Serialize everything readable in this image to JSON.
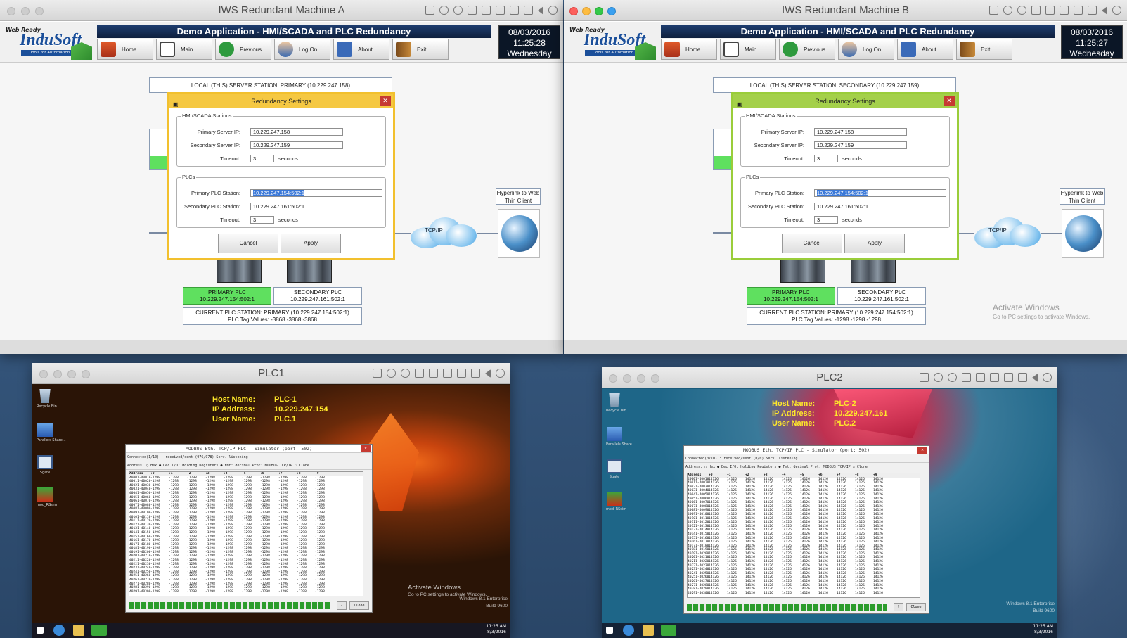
{
  "machine_a": {
    "window_title": "IWS Redundant Machine A",
    "logo": {
      "top": "Web Ready",
      "name": "InduSoft",
      "sub": "Tools for Automation"
    },
    "app_title": "Demo Application - HMI/SCADA and PLC Redundancy",
    "nav": [
      "Home",
      "Main",
      "Previous",
      "Log On...",
      "About...",
      "Exit"
    ],
    "date": "08/03/2016",
    "time": "11:25:28",
    "day": "Wednesday",
    "local_station": "LOCAL (THIS) SERVER STATION: PRIMARY (10.229.247.158)",
    "dialog": {
      "title": "Redundancy Settings",
      "close": "✕",
      "hmi_group": "HMI/SCADA Stations",
      "primary_server_label": "Primary Server IP:",
      "primary_server": "10.229.247.158",
      "secondary_server_label": "Secondary Server IP:",
      "secondary_server": "10.229.247.159",
      "timeout_label": "Timeout:",
      "timeout_hmi": "3",
      "seconds": "seconds",
      "plc_group": "PLCs",
      "primary_plc_label": "Primary PLC Station:",
      "primary_plc": "10.229.247.154:502:1",
      "secondary_plc_label": "Secondary PLC Station:",
      "secondary_plc": "10.229.247.161:502:1",
      "timeout_plc": "3",
      "cancel": "Cancel",
      "apply": "Apply"
    },
    "hyperlink": "Hyperlink to Web Thin Client",
    "cloud_label": "TCP/IP",
    "primary_plc_box": {
      "title": "PRIMARY PLC",
      "ip": "10.229.247.154:502:1"
    },
    "secondary_plc_box": {
      "title": "SECONDARY PLC",
      "ip": "10.229.247.161:502:1"
    },
    "current_station": "CURRENT PLC STATION: PRIMARY (10.229.247.154:502:1)",
    "tag_values": "PLC Tag Values: -3868 -3868 -3868"
  },
  "machine_b": {
    "window_title": "IWS Redundant Machine B",
    "logo": {
      "top": "Web Ready",
      "name": "InduSoft",
      "sub": "Tools for Automation"
    },
    "app_title": "Demo Application - HMI/SCADA and PLC Redundancy",
    "nav": [
      "Home",
      "Main",
      "Previous",
      "Log On...",
      "About...",
      "Exit"
    ],
    "date": "08/03/2016",
    "time": "11:25:27",
    "day": "Wednesday",
    "local_station": "LOCAL (THIS) SERVER STATION: SECONDARY (10.229.247.159)",
    "dialog": {
      "title": "Redundancy Settings",
      "close": "✕",
      "hmi_group": "HMI/SCADA Stations",
      "primary_server_label": "Primary Server IP:",
      "primary_server": "10.229.247.158",
      "secondary_server_label": "Secondary Server IP:",
      "secondary_server": "10.229.247.159",
      "timeout_label": "Timeout:",
      "timeout_hmi": "3",
      "seconds": "seconds",
      "plc_group": "PLCs",
      "primary_plc_label": "Primary PLC Station:",
      "primary_plc": "10.229.247.154:502:1",
      "secondary_plc_label": "Secondary PLC Station:",
      "secondary_plc": "10.229.247.161:502:1",
      "timeout_plc": "3",
      "cancel": "Cancel",
      "apply": "Apply"
    },
    "hyperlink": "Hyperlink to Web Thin Client",
    "cloud_label": "TCP/IP",
    "primary_plc_box": {
      "title": "PRIMARY PLC",
      "ip": "10.229.247.154:502:1"
    },
    "secondary_plc_box": {
      "title": "SECONDARY PLC",
      "ip": "10.229.247.161:502:1"
    },
    "current_station": "CURRENT PLC STATION: PRIMARY (10.229.247.154:502:1)",
    "tag_values": "PLC Tag Values: -1298 -1298 -1298",
    "activate_title": "Activate Windows",
    "activate_sub": "Go to PC settings to activate Windows."
  },
  "plc1": {
    "window_title": "PLC1",
    "host_label": "Host Name:",
    "host": "PLC-1",
    "ip_label": "IP Address:",
    "ip": "10.229.247.154",
    "user_label": "User Name:",
    "user": "PLC.1",
    "desktop_icons": [
      "Recycle Bin",
      "Parallels Share...",
      "Sgate",
      "mod_RSsim"
    ],
    "sim_title": "MODBUS Eth. TCP/IP PLC - Simulator (port: 502)",
    "sim_status": "Connected(1/10) : received/sent (976/978) Serv. listening",
    "sim_opts": "Address: ○ Hex ● Dec   I/O: Holding Registers   ● Fmt: decimal   Prot: MODBUS TCP/IP   ☐ Clone",
    "grid_header": [
      "Address",
      "+0",
      "+1",
      "+2",
      "+3",
      "+4",
      "+5",
      "+6",
      "+7",
      "+8",
      "+9"
    ],
    "grid_addr": [
      "40001-40010",
      "40011-40020",
      "40021-40030",
      "40031-40040",
      "40041-40050",
      "40051-40060",
      "40061-40070",
      "40071-40080",
      "40081-40090",
      "40091-40100",
      "40101-40110",
      "40111-40120",
      "40121-40130",
      "40131-40140",
      "40141-40150",
      "40151-40160",
      "40161-40170",
      "40171-40180",
      "40181-40190",
      "40191-40200",
      "40201-40210",
      "40211-40220",
      "40221-40230",
      "40231-40240",
      "40241-40250",
      "40251-40260",
      "40261-40270",
      "40271-40280",
      "40281-40290",
      "40291-40300"
    ],
    "grid_value": "-1298",
    "sim_btn1": "?",
    "sim_btn2": "Clone",
    "activate_title": "Activate Windows",
    "activate_sub": "Go to PC settings to activate Windows.",
    "edition": "Windows 8.1 Enterprise",
    "build": "Build 9600",
    "clock": "11:25 AM",
    "clock_date": "8/3/2016"
  },
  "plc2": {
    "window_title": "PLC2",
    "host_label": "Host Name:",
    "host": "PLC-2",
    "ip_label": "IP Address:",
    "ip": "10.229.247.161",
    "user_label": "User Name:",
    "user": "PLC.2",
    "desktop_icons": [
      "Recycle Bin",
      "Parallels Share...",
      "Sgate",
      "mod_RSsim"
    ],
    "sim_title": "MODBUS Eth. TCP/IP PLC - Simulator (port: 502)",
    "sim_status": "Connected(0/10) : received/sent (0/0) Serv. listening",
    "sim_opts": "Address: ○ Hex ● Dec   I/O: Holding Registers   ● Fmt: decimal   Prot: MODBUS TCP/IP   ☐ Clone",
    "grid_header": [
      "Address",
      "+0",
      "+1",
      "+2",
      "+3",
      "+4",
      "+5",
      "+6",
      "+7",
      "+8",
      "+9"
    ],
    "grid_addr": [
      "40001-40010",
      "40011-40020",
      "40021-40030",
      "40031-40040",
      "40041-40050",
      "40051-40060",
      "40061-40070",
      "40071-40080",
      "40081-40090",
      "40091-40100",
      "40101-40110",
      "40111-40120",
      "40121-40130",
      "40131-40140",
      "40141-40150",
      "40151-40160",
      "40161-40170",
      "40171-40180",
      "40181-40190",
      "40191-40200",
      "40201-40210",
      "40211-40220",
      "40221-40230",
      "40231-40240",
      "40241-40250",
      "40251-40260",
      "40261-40270",
      "40271-40280",
      "40281-40290",
      "40291-40300"
    ],
    "grid_value": "14126",
    "sim_btn1": "?",
    "sim_btn2": "Clone",
    "edition": "Windows 8.1 Enterprise",
    "build": "Build 9600",
    "clock": "11:25 AM",
    "clock_date": "8/3/2016"
  },
  "colors": {
    "dialog_a_border": "#f2c02e",
    "dialog_b_border": "#9acd3a",
    "plc_green": "#5fe05f"
  }
}
